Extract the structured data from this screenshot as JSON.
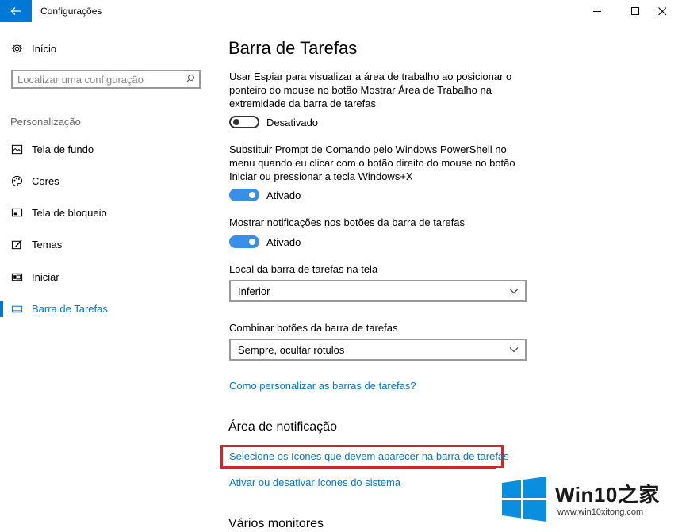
{
  "window": {
    "title": "Configurações"
  },
  "sidebar": {
    "home_label": "Início",
    "search_placeholder": "Localizar uma configuração",
    "section_label": "Personalização",
    "items": [
      {
        "label": "Tela de fundo",
        "icon": "picture-icon"
      },
      {
        "label": "Cores",
        "icon": "palette-icon"
      },
      {
        "label": "Tela de bloqueio",
        "icon": "lock-screen-icon"
      },
      {
        "label": "Temas",
        "icon": "themes-icon"
      },
      {
        "label": "Iniciar",
        "icon": "start-icon"
      },
      {
        "label": "Barra de Tarefas",
        "icon": "taskbar-icon",
        "selected": true
      }
    ]
  },
  "main": {
    "title": "Barra de Tarefas",
    "settings": [
      {
        "description": "Usar Espiar para visualizar a área de trabalho ao posicionar o ponteiro do mouse no botão Mostrar Área de Trabalho na extremidade da barra de tarefas",
        "state": "Desativado",
        "on": false
      },
      {
        "description": "Substituir Prompt de Comando pelo Windows PowerShell no menu quando eu clicar com o botão direito do mouse no botão Iniciar ou pressionar a tecla Windows+X",
        "state": "Ativado",
        "on": true
      },
      {
        "description": "Mostrar notificações nos botões da barra de tarefas",
        "state": "Ativado",
        "on": true
      }
    ],
    "location_label": "Local da barra de tarefas na tela",
    "location_value": "Inferior",
    "combine_label": "Combinar botões da barra de tarefas",
    "combine_value": "Sempre, ocultar rótulos",
    "customize_link": "Como personalizar as barras de tarefas?",
    "notification_heading": "Área de notificação",
    "select_icons_link": "Selecione os ícones que devem aparecer na barra de tarefas",
    "system_icons_link": "Ativar ou desativar ícones do sistema",
    "monitors_heading": "Vários monitores"
  },
  "watermark": {
    "title": "Win10之家",
    "url": "www.win10xitong.com"
  },
  "colors": {
    "accent": "#0078d7",
    "toggle_on": "#3a8ee6",
    "highlight": "#d0262c"
  }
}
